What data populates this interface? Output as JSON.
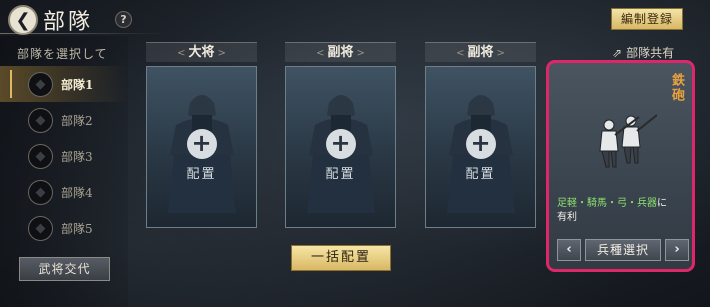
{
  "header": {
    "title": "部隊",
    "help": "?",
    "register_label": "編制登録",
    "share_label": "部隊共有"
  },
  "left_panel": {
    "select_label": "部隊を選択して",
    "units": [
      {
        "label": "部隊1",
        "active": true
      },
      {
        "label": "部隊2",
        "active": false
      },
      {
        "label": "部隊3",
        "active": false
      },
      {
        "label": "部隊4",
        "active": false
      },
      {
        "label": "部隊5",
        "active": false
      }
    ],
    "exchange_label": "武将交代"
  },
  "slots": [
    {
      "role": "大将",
      "place_label": "配置"
    },
    {
      "role": "副将",
      "place_label": "配置"
    },
    {
      "role": "副将",
      "place_label": "配置"
    }
  ],
  "bulk_place_label": "一括配置",
  "troop": {
    "type": "鉄砲",
    "advantage_targets": "足軽・騎馬・弓・兵器",
    "advantage_suffix_1": "に",
    "advantage_suffix_2": "有利",
    "select_label": "兵種選択"
  },
  "colors": {
    "highlight_border": "#e0266a",
    "gold_button": "#d9b764",
    "troop_type": "#e6a040",
    "advantage_text": "#8ee070"
  },
  "icons": [
    "back-arrow-icon",
    "help-icon",
    "share-icon",
    "plus-icon",
    "chevron-left-icon",
    "chevron-right-icon"
  ]
}
